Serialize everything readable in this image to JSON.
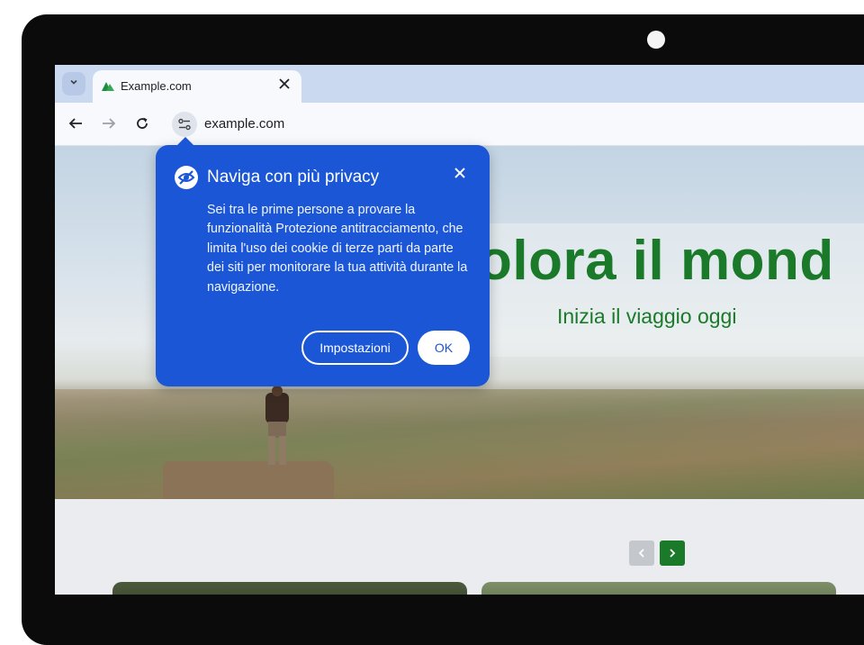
{
  "browser": {
    "tab": {
      "title": "Example.com"
    },
    "toolbar": {
      "url": "example.com"
    }
  },
  "page": {
    "hero_title": "olora il mond",
    "hero_subtitle": "Inizia il viaggio oggi"
  },
  "popup": {
    "title": "Naviga con più privacy",
    "body": "Sei tra le prime persone a provare la funzionalità Protezione antitracciamento, che limita l'uso dei cookie di terze parti da parte dei siti per monitorare la tua attività durante la navigazione.",
    "settings_button": "Impostazioni",
    "ok_button": "OK"
  },
  "icons": {
    "tab_menu": "chevron-down-icon",
    "favicon": "green-globe-icon",
    "close": "close-icon",
    "back": "arrow-left-icon",
    "forward": "arrow-right-icon",
    "reload": "reload-icon",
    "site_settings": "tune-icon",
    "privacy": "eye-off-icon",
    "prev": "chevron-left-icon",
    "next": "chevron-right-icon"
  },
  "colors": {
    "popup_bg": "#1a56d6",
    "hero_text": "#1b7a2a",
    "tabstrip": "#cad8f0"
  }
}
